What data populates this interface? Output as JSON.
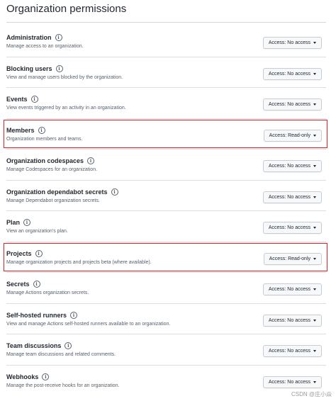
{
  "page": {
    "title": "Organization permissions"
  },
  "info_icon": {
    "name": "info-icon",
    "glyph": "i"
  },
  "permissions": [
    {
      "name": "Administration",
      "description": "Manage access to an organization.",
      "access": "Access: No access",
      "highlighted": false
    },
    {
      "name": "Blocking users",
      "description": "View and manage users blocked by the organization.",
      "access": "Access: No access",
      "highlighted": false
    },
    {
      "name": "Events",
      "description": "View events triggered by an activity in an organization.",
      "access": "Access: No access",
      "highlighted": false
    },
    {
      "name": "Members",
      "description": "Organization members and teams.",
      "access": "Access: Read-only",
      "highlighted": true
    },
    {
      "name": "Organization codespaces",
      "description": "Manage Codespaces for an organization.",
      "access": "Access: No access",
      "highlighted": false
    },
    {
      "name": "Organization dependabot secrets",
      "description": "Manage Dependabot organization secrets.",
      "access": "Access: No access",
      "highlighted": false
    },
    {
      "name": "Plan",
      "description": "View an organization's plan.",
      "access": "Access: No access",
      "highlighted": false
    },
    {
      "name": "Projects",
      "description": "Manage organization projects and projects beta (where available).",
      "access": "Access: Read-only",
      "highlighted": true
    },
    {
      "name": "Secrets",
      "description": "Manage Actions organization secrets.",
      "access": "Access: No access",
      "highlighted": false
    },
    {
      "name": "Self-hosted runners",
      "description": "View and manage Actions self-hosted runners available to an organization.",
      "access": "Access: No access",
      "highlighted": false
    },
    {
      "name": "Team discussions",
      "description": "Manage team discussions and related comments.",
      "access": "Access: No access",
      "highlighted": false
    },
    {
      "name": "Webhooks",
      "description": "Manage the post-receive hooks for an organization.",
      "access": "Access: No access",
      "highlighted": false
    }
  ],
  "highlight_color": "#e02020",
  "watermark": "CSDN @庄小焱"
}
